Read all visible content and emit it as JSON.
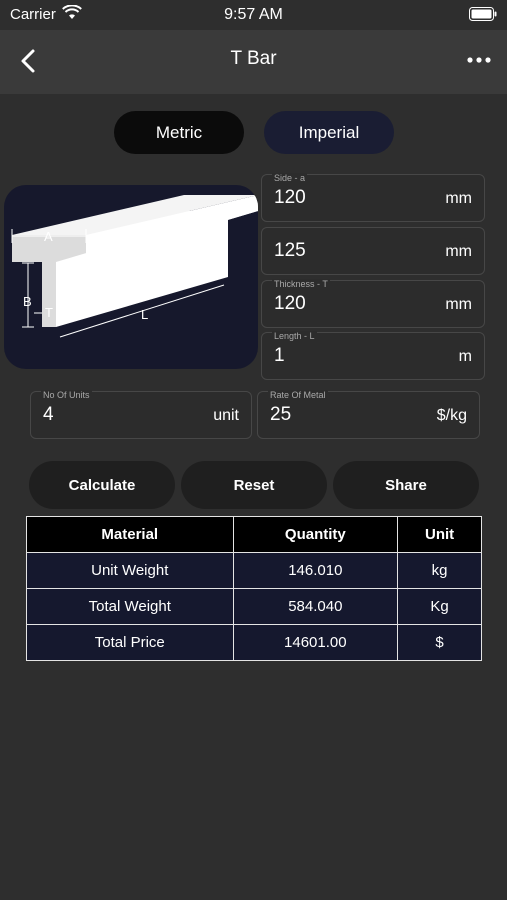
{
  "status_bar": {
    "carrier": "Carrier",
    "time": "9:57 AM"
  },
  "nav": {
    "title": "T Bar",
    "back_icon": "chevron-left-icon",
    "menu_icon": "more-horizontal-icon"
  },
  "unit_toggle": {
    "metric": "Metric",
    "imperial": "Imperial"
  },
  "diagram": {
    "label_a": "A",
    "label_b": "B",
    "label_t": "T",
    "label_l": "L"
  },
  "inputs": {
    "side_a": {
      "label": "Side - a",
      "value": "120",
      "unit": "mm"
    },
    "side_b": {
      "label": "",
      "value": "125",
      "unit": "mm"
    },
    "thickness": {
      "label": "Thickness - T",
      "value": "120",
      "unit": "mm"
    },
    "length": {
      "label": "Length - L",
      "value": "1",
      "unit": "m"
    },
    "units": {
      "label": "No Of Units",
      "value": "4",
      "unit": "unit"
    },
    "rate": {
      "label": "Rate Of Metal",
      "value": "25",
      "unit": "$/kg"
    }
  },
  "buttons": {
    "calculate": "Calculate",
    "reset": "Reset",
    "share": "Share"
  },
  "results": {
    "headers": [
      "Material",
      "Quantity",
      "Unit"
    ],
    "rows": [
      [
        "Unit Weight",
        "146.010",
        "kg"
      ],
      [
        "Total Weight",
        "584.040",
        "Kg"
      ],
      [
        "Total Price",
        "14601.00",
        "$"
      ]
    ]
  }
}
